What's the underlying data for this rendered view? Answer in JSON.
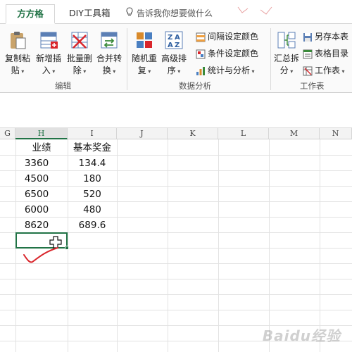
{
  "tabs": {
    "active": "方方格子",
    "diy": "DIY工具箱",
    "tell_me": "告诉我你想要做什么"
  },
  "ribbon": {
    "edit_group": {
      "label": "编辑",
      "buttons": [
        {
          "line1": "复制粘",
          "line2": "贴"
        },
        {
          "line1": "新增插",
          "line2": "入"
        },
        {
          "line1": "批量删",
          "line2": "除"
        },
        {
          "line1": "合并转",
          "line2": "换"
        }
      ]
    },
    "analysis_group": {
      "label": "数据分析",
      "buttons": [
        {
          "line1": "随机重",
          "line2": "复"
        },
        {
          "line1": "高级排",
          "line2": "序"
        }
      ],
      "small": [
        "间隔设定颜色",
        "条件设定颜色",
        "统计与分析"
      ]
    },
    "sheet_group": {
      "label": "工作表",
      "button": {
        "line1": "汇总拆",
        "line2": "分"
      },
      "small": [
        "另存本表",
        "表格目录",
        "工作表"
      ]
    }
  },
  "columns": [
    "G",
    "H",
    "I",
    "J",
    "K",
    "L",
    "M",
    "N"
  ],
  "table": {
    "headers": [
      "业绩",
      "基本奖金"
    ],
    "rows": [
      [
        "3360",
        "134.4"
      ],
      [
        "4500",
        "180"
      ],
      [
        "6500",
        "520"
      ],
      [
        "6000",
        "480"
      ],
      [
        "8620",
        "689.6"
      ]
    ]
  },
  "watermark": "Baidu经验",
  "colors": {
    "accent": "#217346",
    "mark": "#d9252b"
  }
}
